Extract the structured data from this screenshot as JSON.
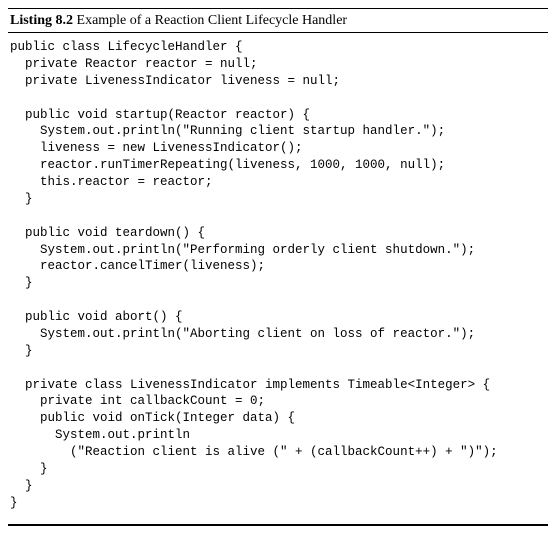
{
  "listing": {
    "label": "Listing 8.2",
    "caption": "Example of a Reaction Client Lifecycle Handler"
  },
  "code": {
    "lines": [
      "public class LifecycleHandler {",
      "  private Reactor reactor = null;",
      "  private LivenessIndicator liveness = null;",
      "",
      "  public void startup(Reactor reactor) {",
      "    System.out.println(\"Running client startup handler.\");",
      "    liveness = new LivenessIndicator();",
      "    reactor.runTimerRepeating(liveness, 1000, 1000, null);",
      "    this.reactor = reactor;",
      "  }",
      "",
      "  public void teardown() {",
      "    System.out.println(\"Performing orderly client shutdown.\");",
      "    reactor.cancelTimer(liveness);",
      "  }",
      "",
      "  public void abort() {",
      "    System.out.println(\"Aborting client on loss of reactor.\");",
      "  }",
      "",
      "  private class LivenessIndicator implements Timeable<Integer> {",
      "    private int callbackCount = 0;",
      "    public void onTick(Integer data) {",
      "      System.out.println",
      "        (\"Reaction client is alive (\" + (callbackCount++) + \")\");",
      "    }",
      "  }",
      "}"
    ]
  }
}
